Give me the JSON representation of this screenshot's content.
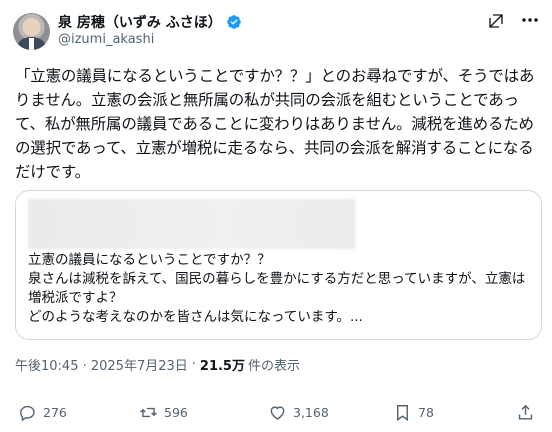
{
  "user": {
    "display_name": "泉 房穂（いずみ ふさほ）",
    "handle": "@izumi_akashi",
    "verified": true
  },
  "header_icons": [
    "grok-icon",
    "more-icon"
  ],
  "tweet": {
    "text": "「立憲の議員になるということですか？？」とのお尋ねですが、そうではありません。立憲の会派と無所属の私が共同の会派を組むということであって、私が無所属の議員であることに変わりはありません。減税を進めるための選択であって、立憲が増税に走るなら、共同の会派を解消することになるだけです。"
  },
  "quote": {
    "text": "立憲の議員になるということですか？？\n泉さんは減税を訴えて、国民の暮らしを豊かにする方だと思っていますが、立憲は増税派ですよ？\nどのような考えなのかを皆さんは気になっています。..."
  },
  "meta": {
    "timestamp": "午後10:45 · 2025年7月23日",
    "separator": "·",
    "views_count": "21.5万",
    "views_label": "件の表示"
  },
  "actions": {
    "replies": "276",
    "reposts": "596",
    "likes": "3,168",
    "bookmarks": "78"
  },
  "colors": {
    "verified": "#1d9bf0",
    "text_primary": "#0f1419",
    "text_secondary": "#536471",
    "border": "#cfd9de"
  }
}
